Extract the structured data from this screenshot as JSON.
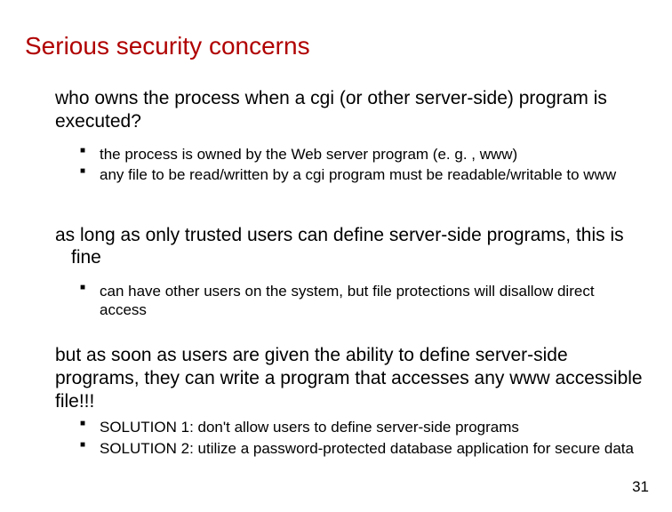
{
  "title": "Serious security concerns",
  "para1": "who owns the process when a cgi (or other server-side) program is executed?",
  "bullets1": [
    "the process is owned by the Web server program (e. g. , www)",
    "any file to be read/written by a cgi program must be readable/writable to www"
  ],
  "para2": "as long as only trusted users can define server-side programs, this is fine",
  "bullets2": [
    "can have other users on the system, but file protections will disallow direct access"
  ],
  "para3": "but as soon as users are given the ability to define server-side programs, they can write a program that accesses any www accessible file!!!",
  "bullets3": [
    "SOLUTION 1: don't allow users to define server-side programs",
    "SOLUTION 2: utilize a password-protected database application for secure data"
  ],
  "page_number": "31"
}
